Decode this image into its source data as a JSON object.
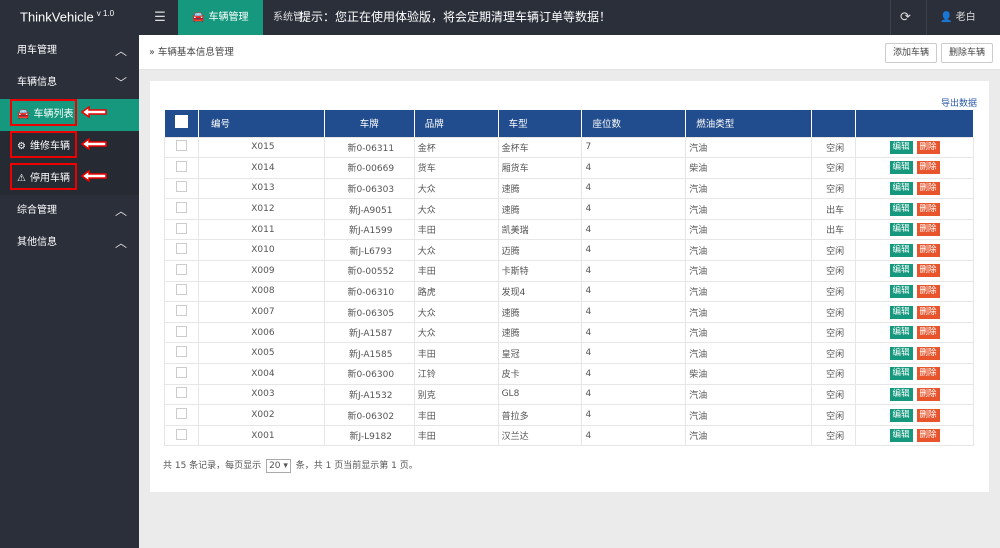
{
  "header": {
    "brand": "ThinkVehicle",
    "version": "v 1.0",
    "menu_icon": "menu-icon",
    "active_tab": "车辆管理",
    "system_tab": "系统管",
    "notice": "提示：您正在使用体验版，将会定期清理车辆订单等数据！",
    "refresh_icon": "refresh-icon",
    "user_name": "老白"
  },
  "sidebar": {
    "groups": [
      {
        "label": "用车管理",
        "chevron": "chevron-up-icon"
      },
      {
        "label": "车辆信息",
        "chevron": "chevron-down-icon"
      },
      {
        "label": "综合管理",
        "chevron": "chevron-up-icon"
      },
      {
        "label": "其他信息",
        "chevron": "chevron-up-icon"
      }
    ],
    "items": [
      {
        "label": "车辆列表",
        "icon": "car-icon"
      },
      {
        "label": "维修车辆",
        "icon": "gear-icon"
      },
      {
        "label": "停用车辆",
        "icon": "warning-icon"
      }
    ]
  },
  "content": {
    "breadcrumb": "车辆基本信息管理",
    "add_button": "添加车辆",
    "delete_button": "删除车辆",
    "export_link": "导出数据"
  },
  "table": {
    "columns": [
      "编号",
      "车牌",
      "品牌",
      "车型",
      "座位数",
      "燃油类型",
      "",
      ""
    ],
    "rows": [
      [
        "X015",
        "新0-06311",
        "金杯",
        "金杯车",
        "7",
        "汽油",
        "空闲"
      ],
      [
        "X014",
        "新0-00669",
        "货车",
        "厢货车",
        "4",
        "柴油",
        "空闲"
      ],
      [
        "X013",
        "新0-06303",
        "大众",
        "速腾",
        "4",
        "汽油",
        "空闲"
      ],
      [
        "X012",
        "新J-A9051",
        "大众",
        "速腾",
        "4",
        "汽油",
        "出车"
      ],
      [
        "X011",
        "新J-A1599",
        "丰田",
        "凯美瑞",
        "4",
        "汽油",
        "出车"
      ],
      [
        "X010",
        "新J-L6793",
        "大众",
        "迈腾",
        "4",
        "汽油",
        "空闲"
      ],
      [
        "X009",
        "新0-00552",
        "丰田",
        "卡斯特",
        "4",
        "汽油",
        "空闲"
      ],
      [
        "X008",
        "新0-06310",
        "路虎",
        "发现4",
        "4",
        "汽油",
        "空闲"
      ],
      [
        "X007",
        "新0-06305",
        "大众",
        "速腾",
        "4",
        "汽油",
        "空闲"
      ],
      [
        "X006",
        "新J-A1587",
        "大众",
        "速腾",
        "4",
        "汽油",
        "空闲"
      ],
      [
        "X005",
        "新J-A1585",
        "丰田",
        "皇冠",
        "4",
        "汽油",
        "空闲"
      ],
      [
        "X004",
        "新0-06300",
        "江铃",
        "皮卡",
        "4",
        "柴油",
        "空闲"
      ],
      [
        "X003",
        "新J-A1532",
        "别克",
        "GL8",
        "4",
        "汽油",
        "空闲"
      ],
      [
        "X002",
        "新0-06302",
        "丰田",
        "普拉多",
        "4",
        "汽油",
        "空闲"
      ],
      [
        "X001",
        "新J-L9182",
        "丰田",
        "汉兰达",
        "4",
        "汽油",
        "空闲"
      ]
    ],
    "edit_label": "编辑",
    "delete_label": "删除"
  },
  "pagination": {
    "prefix": "共 15 条记录，每页显示",
    "page_size": "20",
    "suffix": "条，共 1 页当前显示第 1 页。"
  },
  "colors": {
    "accent": "#16987e",
    "sidebar": "#2b2f3a",
    "table_header": "#214c8d",
    "delete": "#e8542c",
    "annotation": "#ee0000"
  }
}
